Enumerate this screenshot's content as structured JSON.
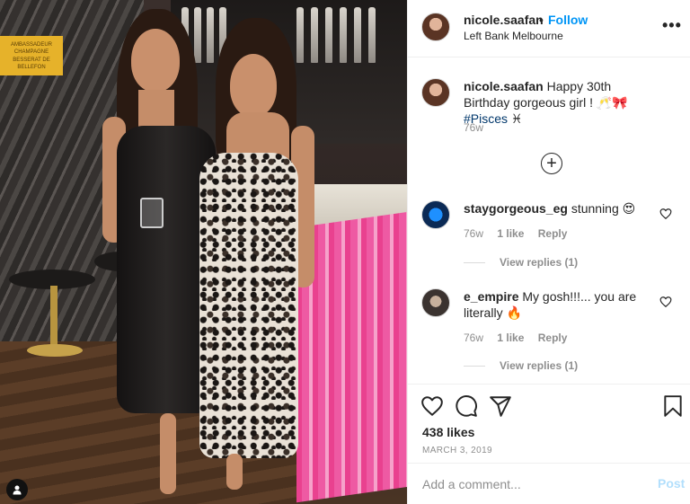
{
  "photo": {
    "sign_line1": "AMBASSADEUR",
    "sign_line2": "CHAMPAGNE",
    "sign_line3": "BESSERAT DE BELLEFON",
    "user_tag_icon": "person-icon"
  },
  "header": {
    "username": "nicole.saafan",
    "separator": "•",
    "follow_label": "Follow",
    "location": "Left Bank Melbourne",
    "more_icon": "ellipsis-icon"
  },
  "caption": {
    "username": "nicole.saafan",
    "text": "Happy 30th Birthday gorgeous girl ! 🥂🎀",
    "hashtag": "#Pisces",
    "emoji_tail": "♓",
    "time": "76w"
  },
  "load_more_icon": "plus-circle-icon",
  "comments": [
    {
      "username": "staygorgeous_eg",
      "text": "stunning 😍",
      "time": "76w",
      "likes": "1 like",
      "reply": "Reply",
      "view_replies": "View replies (1)"
    },
    {
      "username": "e_empire",
      "text": "My gosh!!!... you are literally 🔥",
      "time": "76w",
      "likes": "1 like",
      "reply": "Reply",
      "view_replies": "View replies (1)"
    }
  ],
  "actions": {
    "like_icon": "heart-icon",
    "comment_icon": "comment-bubble-icon",
    "share_icon": "paper-plane-icon",
    "save_icon": "bookmark-icon",
    "likes_count": "438 likes",
    "date": "MARCH 3, 2019"
  },
  "add_comment": {
    "placeholder": "Add a comment...",
    "post_label": "Post"
  },
  "colors": {
    "link_blue": "#0095f6",
    "post_disabled": "#b2dffc",
    "meta_gray": "#8e8e8e",
    "hashtag": "#00376b"
  }
}
